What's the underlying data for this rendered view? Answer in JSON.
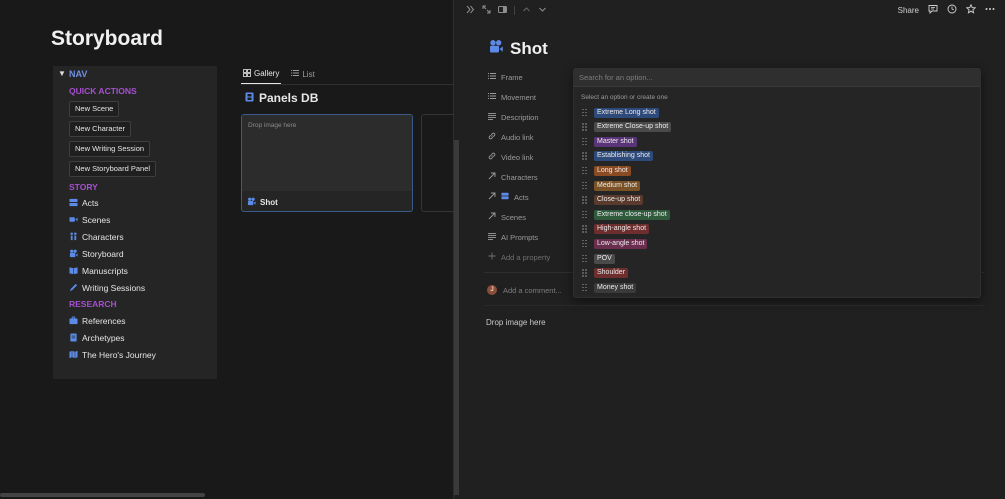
{
  "left": {
    "page_title": "Storyboard",
    "nav": {
      "label": "NAV",
      "toggle_glyph": "▼",
      "quick_actions": {
        "heading": "QUICK ACTIONS",
        "buttons": [
          "New Scene",
          "New Character",
          "New Writing Session",
          "New Storyboard Panel"
        ]
      },
      "story": {
        "heading": "STORY",
        "links": [
          {
            "label": "Acts",
            "icon": "acts-icon"
          },
          {
            "label": "Scenes",
            "icon": "video-camera-icon"
          },
          {
            "label": "Characters",
            "icon": "people-icon"
          },
          {
            "label": "Storyboard",
            "icon": "film-camera-icon"
          },
          {
            "label": "Manuscripts",
            "icon": "book-icon"
          },
          {
            "label": "Writing Sessions",
            "icon": "pencil-icon"
          }
        ]
      },
      "research": {
        "heading": "RESEARCH",
        "links": [
          {
            "label": "References",
            "icon": "briefcase-icon"
          },
          {
            "label": "Archetypes",
            "icon": "document-icon"
          },
          {
            "label": "The Hero's Journey",
            "icon": "map-icon"
          }
        ]
      }
    },
    "views": {
      "tabs": [
        {
          "label": "Gallery",
          "icon": "gallery-icon",
          "active": true
        },
        {
          "label": "List",
          "icon": "list-icon",
          "active": false
        }
      ]
    },
    "database": {
      "title": "Panels DB",
      "card": {
        "drop_text": "Drop image here",
        "title": "Shot"
      }
    }
  },
  "peek": {
    "topbar": {
      "actions": {
        "share_label": "Share"
      }
    },
    "record_title": "Shot",
    "properties": [
      {
        "label": "Frame",
        "icon": "list-lines-icon"
      },
      {
        "label": "Movement",
        "icon": "list-lines-icon"
      },
      {
        "label": "Description",
        "icon": "text-lines-icon"
      },
      {
        "label": "Audio link",
        "icon": "link-icon"
      },
      {
        "label": "Video link",
        "icon": "link-icon"
      },
      {
        "label": "Characters",
        "icon": "relation-arrow-icon"
      },
      {
        "label": "Acts",
        "icon": "relation-arrow-icon"
      },
      {
        "label": "Scenes",
        "icon": "relation-arrow-icon"
      },
      {
        "label": "AI Prompts",
        "icon": "text-lines-icon"
      },
      {
        "label": "Add a property",
        "icon": "plus-icon"
      }
    ],
    "comment": {
      "avatar_initial": "J",
      "placeholder": "Add a comment..."
    },
    "drop_text": "Drop image here",
    "dropdown": {
      "search_placeholder": "Search for an option...",
      "hint": "Select an option or create one",
      "options": [
        {
          "label": "Extreme Long shot",
          "color": "#2e4a7a"
        },
        {
          "label": "Extreme Close-up shot",
          "color": "#4a4a4a"
        },
        {
          "label": "Master shot",
          "color": "#5a3478"
        },
        {
          "label": "Establishing shot",
          "color": "#2e4a7a"
        },
        {
          "label": "Long shot",
          "color": "#8a4a22"
        },
        {
          "label": "Medium shot",
          "color": "#7a5226"
        },
        {
          "label": "Close-up shot",
          "color": "#5a3a2c"
        },
        {
          "label": "Extreme close-up shot",
          "color": "#2f5a3c"
        },
        {
          "label": "High-angle shot",
          "color": "#6e2e2e"
        },
        {
          "label": "Low-angle shot",
          "color": "#6a2e4e"
        },
        {
          "label": "POV",
          "color": "#4a4a4a"
        },
        {
          "label": "Shoulder",
          "color": "#6e2e2e"
        },
        {
          "label": "Money shot",
          "color": "#3a3a3a"
        }
      ]
    }
  },
  "colors": {
    "accent_blue": "#5c8ae6",
    "section_purple": "#a64fd0",
    "nav_blue": "#6f8fe0"
  }
}
